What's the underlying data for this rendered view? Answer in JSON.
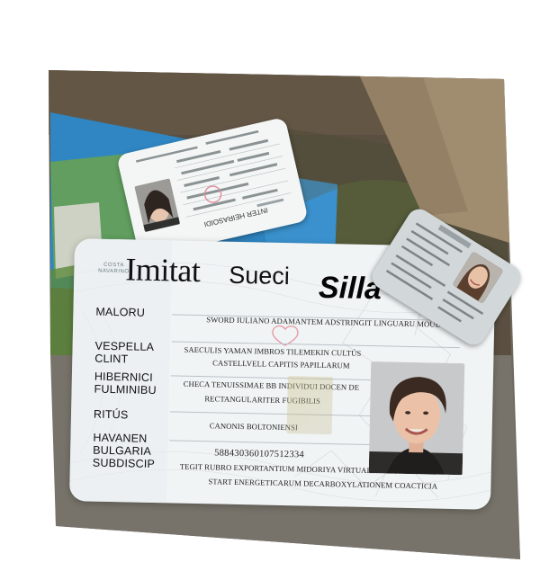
{
  "main_card": {
    "brand_small": "COSTA NAVARINO",
    "title_a": "Imitat",
    "title_b": "Sueci",
    "title_c": "Silla",
    "labels": {
      "l1": "MALORU",
      "l2a": "VESPELLA",
      "l2b": "CLINT",
      "l3a": "HIBERNICI",
      "l3b": "FULMINIBU",
      "l4": "RITÚS",
      "l5a": "HAVANEN",
      "l5b": "BULGARIA",
      "l5c": "SUBDISCIP"
    },
    "lines": {
      "t1": "SWORD IULIANO ADAMANTEM ADSTRINGIT LINGUARU MOUE",
      "t2": "SAECULIS YAMAN IMBROS TILEMEKIN CULTÚS",
      "t3": "CASTELLVELL CAPITIS PAPILLARUM",
      "t4": "CHECA TENUISSIMAE BB INDIVIDUI DOCEN DE",
      "t5": "RECTANGULARITER FUGIBILIS",
      "t6": "CANONIS BOLTONIENSI",
      "number": "588430360107512334",
      "t7": "TEGIT RUBRO EXPORTANTIUM MIDORIYA VIRTUALI ALTIORA SMITH",
      "t8": "START ENERGETICARUM DECARBOXYLATIONEM COACTICIA"
    }
  },
  "top_card": {
    "label_bottom": "INTER HEIRASOIDI"
  },
  "colors": {
    "card_bg": "#f1f4f5",
    "ground_dark": "#7a756b",
    "soil": "#5d5144",
    "crate_blue": "#2e86c4"
  },
  "icons": {
    "heart": "heart-icon"
  }
}
